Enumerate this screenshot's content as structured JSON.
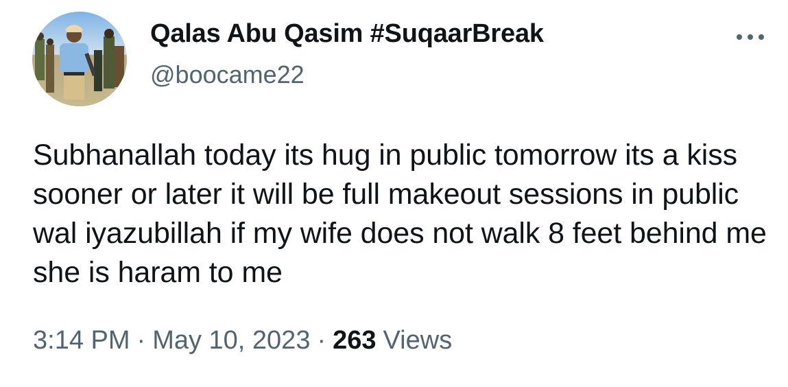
{
  "author": {
    "display_name": "Qalas Abu Qasim #SuqaarBreak",
    "handle": "@boocame22"
  },
  "more_icon": "ellipsis-horizontal-icon",
  "tweet": {
    "text": "Subhanallah today its hug in public tomorrow its a kiss sooner or later it will be full makeout sessions in public wal iyazubillah if my wife does not walk 8 feet behind me she is haram to me"
  },
  "meta": {
    "time": "3:14 PM",
    "separator": "·",
    "date": "May 10, 2023",
    "views_count": "263",
    "views_label": "Views"
  },
  "colors": {
    "text_primary": "#0f1419",
    "text_secondary": "#536471",
    "background": "#ffffff"
  }
}
